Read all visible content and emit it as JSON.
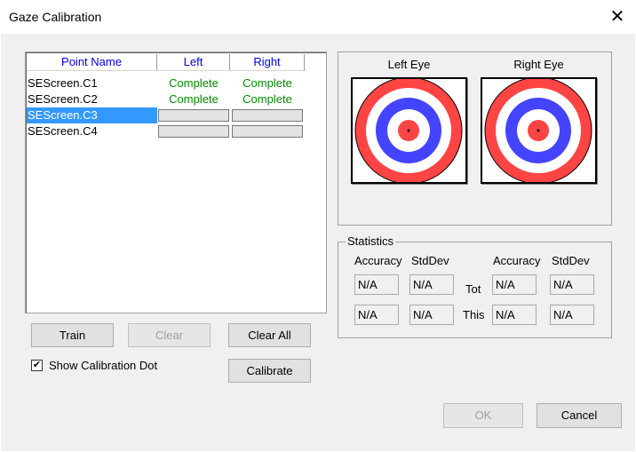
{
  "window": {
    "title": "Gaze Calibration",
    "close_glyph": "✕"
  },
  "list": {
    "headers": {
      "name": "Point Name",
      "left": "Left",
      "right": "Right"
    },
    "rows": [
      {
        "name": "SEScreen.C1",
        "left": "Complete",
        "right": "Complete"
      },
      {
        "name": "SEScreen.C2",
        "left": "Complete",
        "right": "Complete"
      },
      {
        "name": "SEScreen.C3",
        "left": "",
        "right": ""
      },
      {
        "name": "SEScreen.C4",
        "left": "",
        "right": ""
      }
    ],
    "selected_index": 2
  },
  "buttons": {
    "train": "Train",
    "clear": "Clear",
    "clear_all": "Clear All",
    "calibrate": "Calibrate",
    "ok": "OK",
    "cancel": "Cancel"
  },
  "checkbox": {
    "label": "Show Calibration Dot",
    "checked": true,
    "mark": "✔"
  },
  "eyes": {
    "left_label": "Left Eye",
    "right_label": "Right Eye"
  },
  "target_colors": {
    "outer": "#ff4444",
    "mid": "#4444ff",
    "center": "#ff4444",
    "ring": "#ffffff"
  },
  "statistics": {
    "legend": "Statistics",
    "accuracy_label": "Accuracy",
    "stddev_label": "StdDev",
    "tot_label": "Tot",
    "this_label": "This",
    "values": {
      "left_tot_acc": "N/A",
      "left_tot_std": "N/A",
      "right_tot_acc": "N/A",
      "right_tot_std": "N/A",
      "left_this_acc": "N/A",
      "left_this_std": "N/A",
      "right_this_acc": "N/A",
      "right_this_std": "N/A"
    }
  }
}
